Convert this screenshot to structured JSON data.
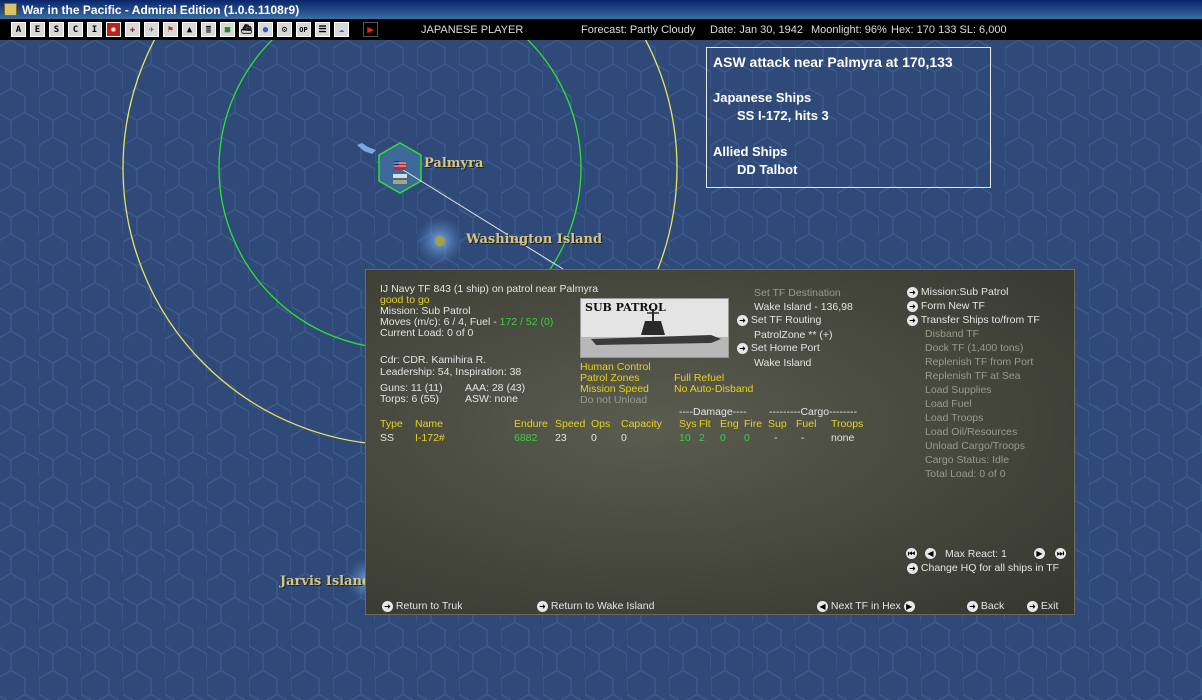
{
  "window": {
    "title": "War in the Pacific - Admiral Edition (1.0.6.1108r9)"
  },
  "toolbar": {
    "buttons": [
      "A",
      "E",
      "S",
      "C",
      "I",
      "",
      "",
      "",
      "",
      "",
      "",
      "",
      "",
      "",
      "",
      "",
      "OP",
      "",
      ""
    ],
    "player": "JAPANESE PLAYER",
    "forecast": "Forecast: Partly Cloudy",
    "date": "Date: Jan 30, 1942",
    "moonlight": "Moonlight: 96%",
    "hex": "Hex: 170 133  SL: 6,000"
  },
  "map": {
    "labels": {
      "palmyra": "Palmyra",
      "washington": "Washington Island",
      "jarvis": "Jarvis Island"
    }
  },
  "combat_report": {
    "title": "ASW attack near Palmyra  at 170,133",
    "japanese_header": "Japanese Ships",
    "japanese_ship": "SS I-172, hits 3",
    "allied_header": "Allied Ships",
    "allied_ship": "DD Talbot"
  },
  "tf": {
    "header": "IJ Navy TF 843 (1 ship)  on patrol near Palmyra",
    "status": "good to go",
    "mission": "Mission: Sub Patrol",
    "moves_prefix": "Moves (m/c): 6 / 4, Fuel - ",
    "fuel": "172 / 52 (0)",
    "load": "Current Load: 0 of 0",
    "commander": "Cdr: CDR. Kamihira R.",
    "leadership": "Leadership: 54, Inspiration: 38",
    "guns": "Guns: 11 (11)",
    "aaa": "AAA: 28 (43)",
    "torps": "Torps: 6 (55)",
    "asw": "ASW: none",
    "pic_label": "SUB PATROL",
    "opts": {
      "human_control": "Human Control",
      "patrol_zones": "Patrol Zones",
      "full_refuel": "Full Refuel",
      "mission_speed": "Mission Speed",
      "no_auto_disband": "No Auto-Disband",
      "do_not_unload": "Do not Unload"
    },
    "dest": {
      "set_dest": "Set TF Destination",
      "dest_val": "Wake Island - 136,98",
      "set_routing": "Set TF Routing",
      "patrol_zone": "PatrolZone ** (+)",
      "set_home": "Set Home Port",
      "home_val": "Wake Island"
    },
    "table": {
      "damage_header": "----Damage----",
      "cargo_header": "---------Cargo--------",
      "cols": {
        "type": "Type",
        "name": "Name",
        "endure": "Endure",
        "speed": "Speed",
        "ops": "Ops",
        "capacity": "Capacity",
        "sys": "Sys",
        "flt": "Flt",
        "eng": "Eng",
        "fire": "Fire",
        "sup": "Sup",
        "fuel": "Fuel",
        "troops": "Troops"
      },
      "row": {
        "type": "SS",
        "name": "I-172#",
        "endure": "6882",
        "speed": "23",
        "ops": "0",
        "capacity": "0",
        "sys": "10",
        "flt": "2",
        "eng": "0",
        "fire": "0",
        "sup": "-",
        "fuel": "-",
        "troops": "none"
      }
    },
    "commands": {
      "mission": "Mission:Sub Patrol",
      "form_new": "Form New TF",
      "transfer": "Transfer Ships to/from TF",
      "disband": "Disband TF",
      "dock": "Dock TF (1,400 tons)",
      "replenish_port": "Replenish TF from Port",
      "replenish_sea": "Replenish TF at Sea",
      "load_supplies": "Load Supplies",
      "load_fuel": "Load Fuel",
      "load_troops": "Load Troops",
      "load_oil": "Load Oil/Resources",
      "unload": "Unload Cargo/Troops",
      "cargo_status": "Cargo Status: Idle",
      "total_load": "Total Load: 0 of 0"
    },
    "max_react": "Max React:  1",
    "change_hq": "Change HQ for all ships in TF",
    "bottom": {
      "return_truk": "Return to Truk",
      "return_wake": "Return to Wake Island",
      "next_tf": "Next TF in Hex",
      "back": "Back",
      "exit": "Exit"
    }
  }
}
